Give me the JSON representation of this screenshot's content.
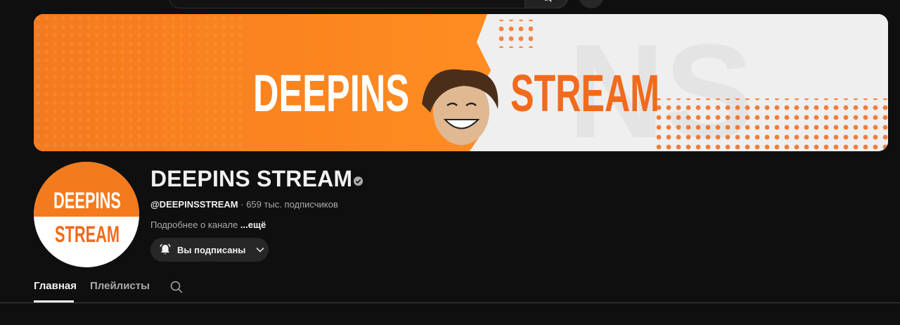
{
  "header": {
    "icons": [
      "search-icon",
      "mic-icon"
    ]
  },
  "banner": {
    "word_left": "DEEPINS",
    "word_right": "STREAM",
    "colors": {
      "orange": "#f26a1b",
      "orange_light": "#ff8a2a",
      "light": "#efefef"
    }
  },
  "avatar": {
    "line1": "DEEPINS",
    "line2": "STREAM"
  },
  "channel": {
    "name": "DEEPINS STREAM",
    "handle": "@DEEPINSSTREAM",
    "separator": " · ",
    "subscribers": "659 тыс. подписчиков",
    "about": "Подробнее о канале ",
    "more": "...ещё"
  },
  "subscribe": {
    "label": "Вы подписаны",
    "icon": "bell-icon"
  },
  "tabs": [
    {
      "label": "Главная",
      "active": true
    },
    {
      "label": "Плейлисты",
      "active": false
    }
  ]
}
